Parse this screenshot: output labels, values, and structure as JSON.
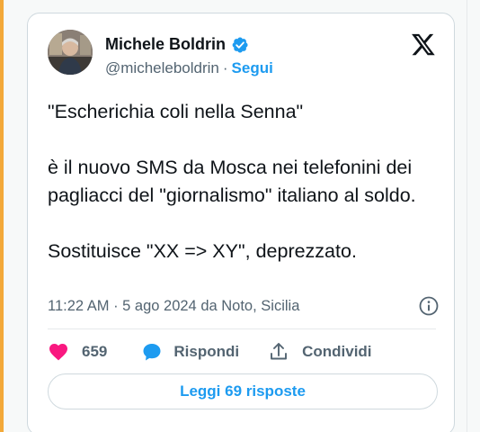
{
  "author": {
    "display_name": "Michele Boldrin",
    "handle": "@micheleboldrin",
    "separator": "·",
    "follow_label": "Segui"
  },
  "tweet": {
    "paragraphs": [
      "\"Escherichia coli nella Senna\"",
      "è il nuovo SMS da Mosca nei telefonini dei pagliacci del \"giornalismo\" italiano al soldo.",
      "Sostituisce \"XX => XY\", deprezzato."
    ],
    "timestamp": "11:22 AM · 5 ago 2024 da Noto, Sicilia"
  },
  "actions": {
    "like_count": "659",
    "reply_label": "Rispondi",
    "share_label": "Condividi"
  },
  "read_replies_label": "Leggi 69 risposte",
  "colors": {
    "accent_blue": "#1d9bf0",
    "like_pink": "#f91880",
    "text_dark": "#0f1419",
    "text_muted": "#536471",
    "left_accent": "#f3a93a"
  },
  "icons": {
    "verified": "verified-badge-icon",
    "brand": "x-logo-icon",
    "info": "info-icon",
    "like": "heart-icon",
    "reply": "speech-bubble-icon",
    "share": "share-icon"
  }
}
